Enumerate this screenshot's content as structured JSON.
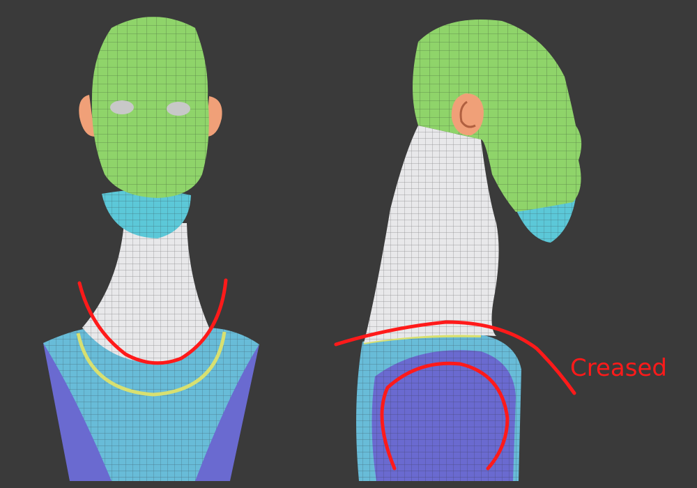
{
  "annotation": {
    "label": "Creased",
    "color": "#ff1a1a"
  },
  "colors": {
    "background": "#3a3a3a",
    "head_region": "#8fd46a",
    "ear_region": "#f0a078",
    "chin_region": "#5cc8d8",
    "neck_region": "#e8e8ea",
    "shoulder_region": "#68bcd8",
    "shoulder_side": "#6a6ad0",
    "collar_line": "#d8e070"
  }
}
